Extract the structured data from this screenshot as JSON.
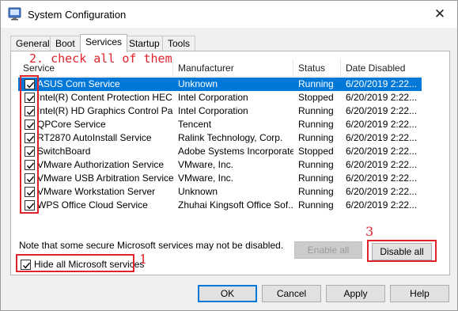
{
  "window": {
    "title": "System Configuration",
    "close_glyph": "✕"
  },
  "tabs": [
    {
      "label": "General"
    },
    {
      "label": "Boot"
    },
    {
      "label": "Services"
    },
    {
      "label": "Startup"
    },
    {
      "label": "Tools"
    }
  ],
  "table": {
    "columns": [
      "Service",
      "Manufacturer",
      "Status",
      "Date Disabled"
    ],
    "rows": [
      {
        "service": "ASUS Com Service",
        "manufacturer": "Unknown",
        "status": "Running",
        "date": "6/20/2019 2:22...",
        "checked": true,
        "selected": true
      },
      {
        "service": "Intel(R) Content Protection HEC...",
        "manufacturer": "Intel Corporation",
        "status": "Stopped",
        "date": "6/20/2019 2:22...",
        "checked": true,
        "selected": false
      },
      {
        "service": "Intel(R) HD Graphics Control Pa...",
        "manufacturer": "Intel Corporation",
        "status": "Running",
        "date": "6/20/2019 2:22...",
        "checked": true,
        "selected": false
      },
      {
        "service": "QPCore Service",
        "manufacturer": "Tencent",
        "status": "Running",
        "date": "6/20/2019 2:22...",
        "checked": true,
        "selected": false
      },
      {
        "service": "RT2870 AutoInstall Service",
        "manufacturer": "Ralink Technology, Corp.",
        "status": "Running",
        "date": "6/20/2019 2:22...",
        "checked": true,
        "selected": false
      },
      {
        "service": "SwitchBoard",
        "manufacturer": "Adobe Systems Incorporated",
        "status": "Stopped",
        "date": "6/20/2019 2:22...",
        "checked": true,
        "selected": false
      },
      {
        "service": "VMware Authorization Service",
        "manufacturer": "VMware, Inc.",
        "status": "Running",
        "date": "6/20/2019 2:22...",
        "checked": true,
        "selected": false
      },
      {
        "service": "VMware USB Arbitration Service",
        "manufacturer": "VMware, Inc.",
        "status": "Running",
        "date": "6/20/2019 2:22...",
        "checked": true,
        "selected": false
      },
      {
        "service": "VMware Workstation Server",
        "manufacturer": "Unknown",
        "status": "Running",
        "date": "6/20/2019 2:22...",
        "checked": true,
        "selected": false
      },
      {
        "service": "WPS Office Cloud Service",
        "manufacturer": "Zhuhai Kingsoft Office Sof...",
        "status": "Running",
        "date": "6/20/2019 2:22...",
        "checked": true,
        "selected": false
      }
    ]
  },
  "note": "Note that some secure Microsoft services may not be disabled.",
  "hide_ms": {
    "label": "Hide all Microsoft services",
    "checked": true
  },
  "buttons": {
    "enable_all": "Enable all",
    "disable_all": "Disable all",
    "ok": "OK",
    "cancel": "Cancel",
    "apply": "Apply",
    "help": "Help"
  },
  "annotations": {
    "step1": "1",
    "step2": "2. check all of them",
    "step3": "3",
    "color": "#e0232b"
  },
  "colors": {
    "selection": "#0078d7",
    "window_bg": "#f0f0f0"
  }
}
